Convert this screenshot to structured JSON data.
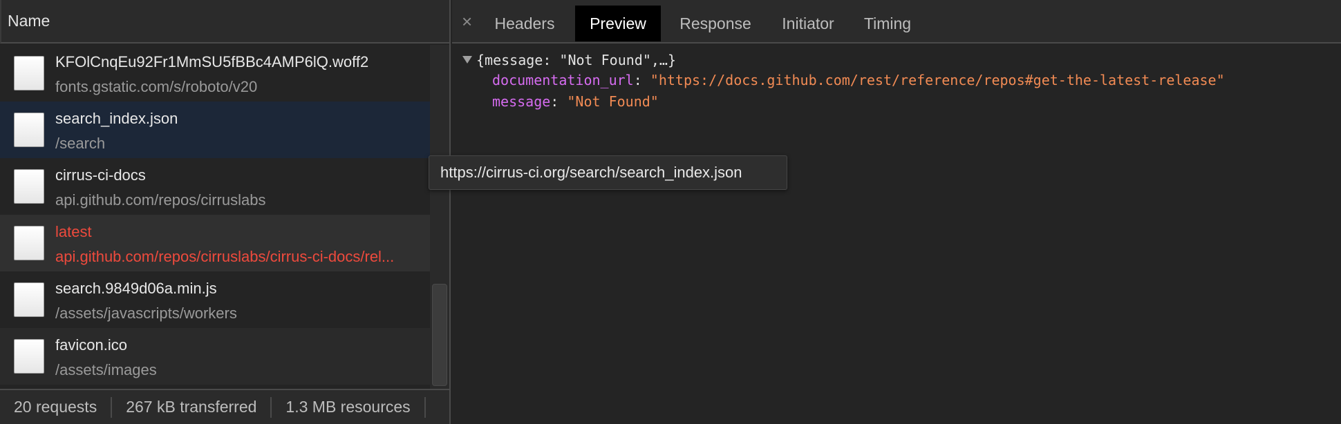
{
  "left": {
    "header": "Name",
    "requests": [
      {
        "name": "KFOlCnqEu92Fr1MmSU5fBBc4AMP6lQ.woff2",
        "path": "fonts.gstatic.com/s/roboto/v20",
        "state": "normal"
      },
      {
        "name": "search_index.json",
        "path": "/search",
        "state": "selected"
      },
      {
        "name": "cirrus-ci-docs",
        "path": "api.github.com/repos/cirruslabs",
        "state": "normal"
      },
      {
        "name": "latest",
        "path": "api.github.com/repos/cirruslabs/cirrus-ci-docs/rel...",
        "state": "error"
      },
      {
        "name": "search.9849d06a.min.js",
        "path": "/assets/javascripts/workers",
        "state": "normal"
      },
      {
        "name": "favicon.ico",
        "path": "/assets/images",
        "state": "normal"
      }
    ],
    "status": {
      "requests": "20 requests",
      "transferred": "267 kB transferred",
      "resources": "1.3 MB resources"
    }
  },
  "tabs": {
    "close_glyph": "×",
    "items": [
      "Headers",
      "Preview",
      "Response",
      "Initiator",
      "Timing"
    ],
    "active": "Preview"
  },
  "preview": {
    "summary": "{message: \"Not Found\",…}",
    "fields": [
      {
        "key": "documentation_url",
        "value": "\"https://docs.github.com/rest/reference/repos#get-the-latest-release\""
      },
      {
        "key": "message",
        "value": "\"Not Found\""
      }
    ]
  },
  "tooltip": "https://cirrus-ci.org/search/search_index.json",
  "colors": {
    "error": "#ee4a3d",
    "json_key": "#d66cf0",
    "json_string": "#f28b54",
    "selected_row": "#1c2738"
  }
}
